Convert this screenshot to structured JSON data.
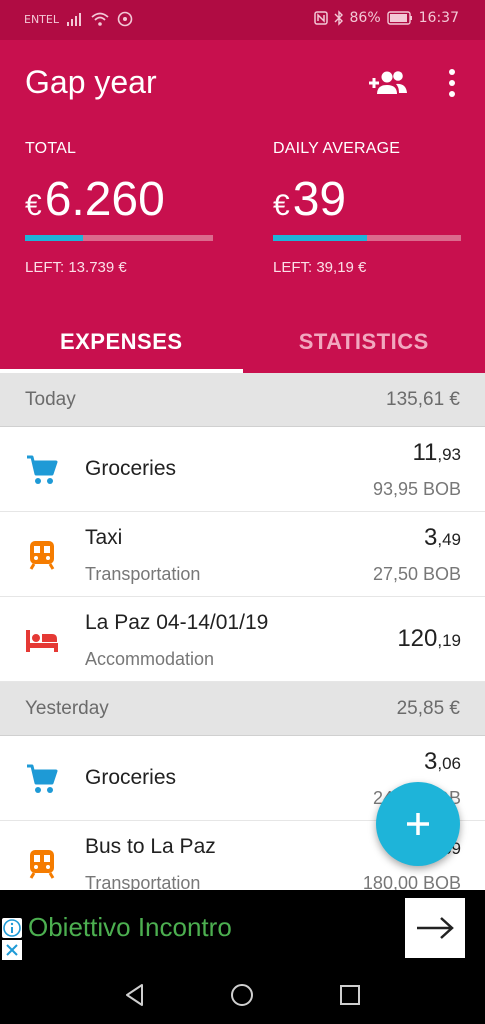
{
  "status_bar": {
    "carrier": "ENTEL",
    "battery": "86%",
    "time": "16:37"
  },
  "header": {
    "title": "Gap year",
    "add_person_icon": "add-person-icon",
    "menu_icon": "more-vert-icon"
  },
  "total": {
    "label": "TOTAL",
    "currency": "€",
    "value": "6.260",
    "progress": 0.31,
    "left": "LEFT: 13.739 €"
  },
  "daily": {
    "label": "DAILY AVERAGE",
    "currency": "€",
    "value": "39",
    "progress": 0.5,
    "left": "LEFT: 39,19 €"
  },
  "tabs": [
    {
      "label": "EXPENSES",
      "active": true
    },
    {
      "label": "STATISTICS",
      "active": false
    }
  ],
  "days": [
    {
      "label": "Today",
      "total": "135,61 €",
      "items": [
        {
          "icon": "cart-icon",
          "name": "Groceries",
          "category": "",
          "amount_int": "11",
          "amount_dec": ",93",
          "original": "93,95 BOB"
        },
        {
          "icon": "train-icon",
          "name": "Taxi",
          "category": "Transportation",
          "amount_int": "3",
          "amount_dec": ",49",
          "original": "27,50 BOB"
        },
        {
          "icon": "bed-icon",
          "name": "La Paz 04-14/01/19",
          "category": "Accommodation",
          "amount_int": "120",
          "amount_dec": ",19",
          "original": ""
        }
      ]
    },
    {
      "label": "Yesterday",
      "total": "25,85 €",
      "items": [
        {
          "icon": "cart-icon",
          "name": "Groceries",
          "category": "",
          "amount_int": "3",
          "amount_dec": ",06",
          "original": "24,45 BOB"
        },
        {
          "icon": "train-icon",
          "name": "Bus to La Paz",
          "category": "Transportation",
          "amount_int": "22",
          "amount_dec": ",69",
          "original": "180,00 BOB"
        }
      ]
    }
  ],
  "fab": {
    "icon": "plus-icon"
  },
  "ad": {
    "text": "Obiettivo Incontro",
    "arrow_icon": "arrow-right-icon"
  },
  "colors": {
    "primary": "#c8104e",
    "status_bar": "#b00c43",
    "accent": "#1eb4d9",
    "transport": "#f57c00",
    "accommodation": "#e53935"
  }
}
